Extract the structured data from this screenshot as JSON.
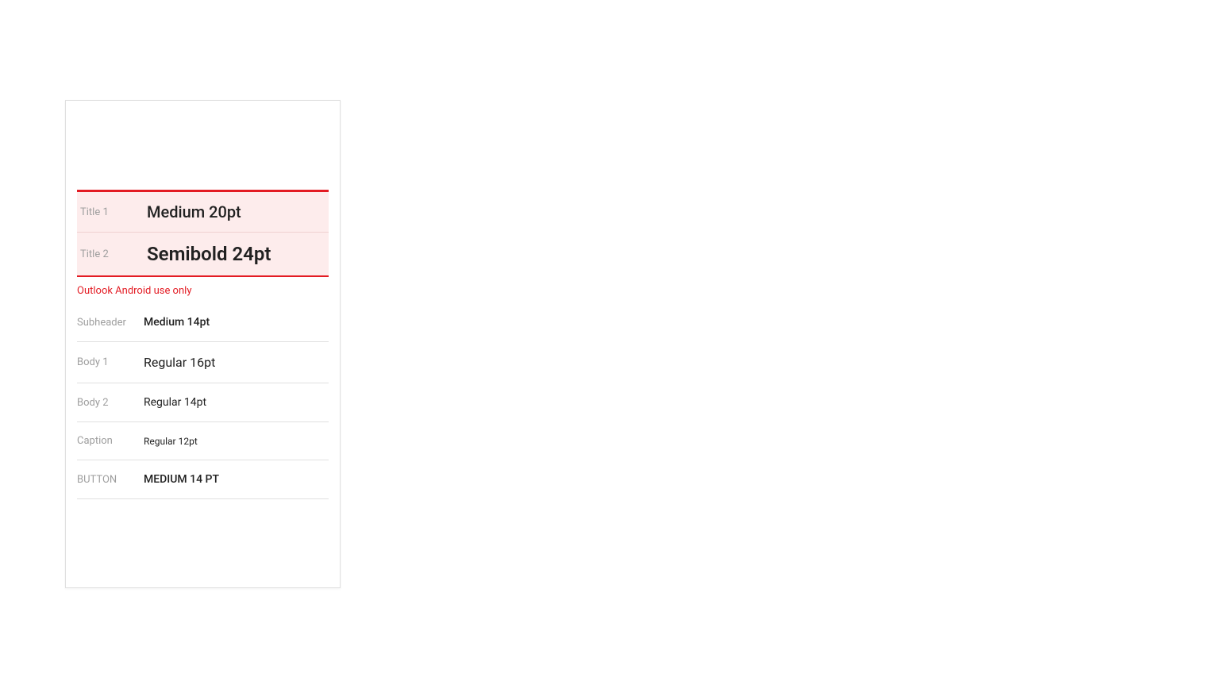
{
  "typography": {
    "highlighted": [
      {
        "label": "Title 1",
        "value": "Medium 20pt",
        "class": "title1"
      },
      {
        "label": "Title 2",
        "value": "Semibold 24pt",
        "class": "title2"
      }
    ],
    "annotation": "Outlook Android use only",
    "rows": [
      {
        "label": "Subheader",
        "value": "Medium 14pt",
        "class": "subheader"
      },
      {
        "label": "Body 1",
        "value": "Regular 16pt",
        "class": "body1"
      },
      {
        "label": "Body 2",
        "value": "Regular 14pt",
        "class": "body2"
      },
      {
        "label": "Caption",
        "value": "Regular 12pt",
        "class": "caption"
      },
      {
        "label": "BUTTON",
        "value": "MEDIUM 14 PT",
        "class": "button-style",
        "labelClass": "button-label"
      }
    ]
  }
}
